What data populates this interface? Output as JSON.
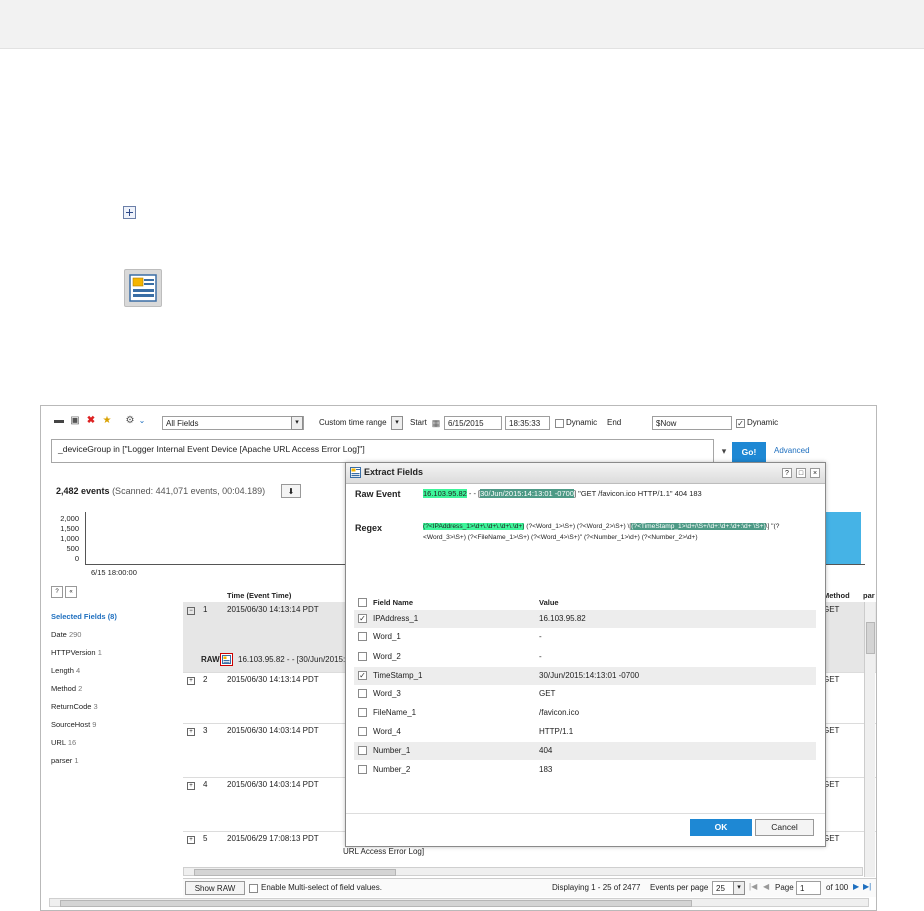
{
  "toolbar": {
    "field_select": "All Fields",
    "time_range": "Custom time range",
    "start_label": "Start",
    "start_date": "6/15/2015",
    "start_time": "18:35:33",
    "dynamic_label": "Dynamic",
    "end_label": "End",
    "end_value": "$Now",
    "end_dynamic_label": "Dynamic"
  },
  "query": {
    "text": "_deviceGroup in [\"Logger Internal Event Device [Apache URL Access Error Log]\"]",
    "go_label": "Go!",
    "advanced_label": "Advanced"
  },
  "summary": {
    "events": "2,482 events",
    "scanned": "(Scanned: 441,071 events, 00:04.189)"
  },
  "chart_data": {
    "type": "bar",
    "yticks": [
      "2,000",
      "1,500",
      "1,000",
      "500",
      "0"
    ],
    "ylim": [
      0,
      2500
    ],
    "x_start_label": "6/15 18:00:00",
    "values": [
      2482
    ]
  },
  "sidebar": {
    "title": "Selected Fields (8)",
    "items": [
      {
        "name": "Date",
        "count": "290"
      },
      {
        "name": "HTTPVersion",
        "count": "1"
      },
      {
        "name": "Length",
        "count": "4"
      },
      {
        "name": "Method",
        "count": "2"
      },
      {
        "name": "ReturnCode",
        "count": "3"
      },
      {
        "name": "SourceHost",
        "count": "9"
      },
      {
        "name": "URL",
        "count": "16"
      },
      {
        "name": "parser",
        "count": "1"
      }
    ]
  },
  "table": {
    "time_header": "Time (Event Time)",
    "method_header": "Method",
    "extra_header": "par",
    "raw_label": "RAW",
    "raw_text": "16.103.95.82 - - [30/Jun/2015:",
    "rows": [
      {
        "num": "1",
        "time": "2015/06/30 14:13:14 PDT",
        "method": "GET"
      },
      {
        "num": "2",
        "time": "2015/06/30 14:13:14 PDT",
        "method": "GET"
      },
      {
        "num": "3",
        "time": "2015/06/30 14:03:14 PDT",
        "method": "GET"
      },
      {
        "num": "4",
        "time": "2015/06/30 14:03:14 PDT",
        "method": "GET"
      },
      {
        "num": "5",
        "time": "2015/06/29 17:08:13 PDT",
        "method": "GET"
      }
    ],
    "row5_extra": "URL Access Error Log]"
  },
  "bottombar": {
    "show_raw": "Show RAW",
    "multi_select": "Enable Multi-select of field values.",
    "displaying": "Displaying 1 - 25 of 2477",
    "events_per_page_label": "Events per page",
    "per_page": "25",
    "page_label": "Page",
    "page_value": "1",
    "of_pages": "of 100"
  },
  "dialog": {
    "title": "Extract Fields",
    "raw_event_label": "Raw Event",
    "raw_ip": "16.103.95.82",
    "raw_sep": " - - [",
    "raw_ts": "30/Jun/2015:14:13:01 -0700",
    "raw_rest": "] \"GET /favicon.ico HTTP/1.1\" 404 183",
    "regex_label": "Regex",
    "regex_ip": "(?<IPAddress_1>\\d+\\.\\d+\\.\\d+\\.\\d+)",
    "regex_mid": " (?<Word_1>\\S+) (?<Word_2>\\S+) \\[",
    "regex_ts": "(?<TimeStamp_1>\\d+/\\S+/\\d+:\\d+:\\d+:\\d+ \\S+)",
    "regex_end": "\\] \"(?<Word_3>\\S+) (?<FileName_1>\\S+) (?<Word_4>\\S+)\" (?<Number_1>\\d+) (?<Number_2>\\d+)",
    "col_field": "Field Name",
    "col_value": "Value",
    "fields": [
      {
        "name": "IPAddress_1",
        "value": "16.103.95.82",
        "checked": true
      },
      {
        "name": "Word_1",
        "value": "-",
        "checked": false
      },
      {
        "name": "Word_2",
        "value": "-",
        "checked": false
      },
      {
        "name": "TimeStamp_1",
        "value": "30/Jun/2015:14:13:01 -0700",
        "checked": true
      },
      {
        "name": "Word_3",
        "value": "GET",
        "checked": false
      },
      {
        "name": "FileName_1",
        "value": "/favicon.ico",
        "checked": false
      },
      {
        "name": "Word_4",
        "value": "HTTP/1.1",
        "checked": false
      },
      {
        "name": "Number_1",
        "value": "404",
        "checked": false
      },
      {
        "name": "Number_2",
        "value": "183",
        "checked": false
      }
    ],
    "ok_label": "OK",
    "cancel_label": "Cancel"
  },
  "colors": {
    "accent": "#1e88d4",
    "highlight_ip": "#3df59a",
    "highlight_ts": "#4d9a86",
    "chart_bar": "#45b3e6"
  }
}
